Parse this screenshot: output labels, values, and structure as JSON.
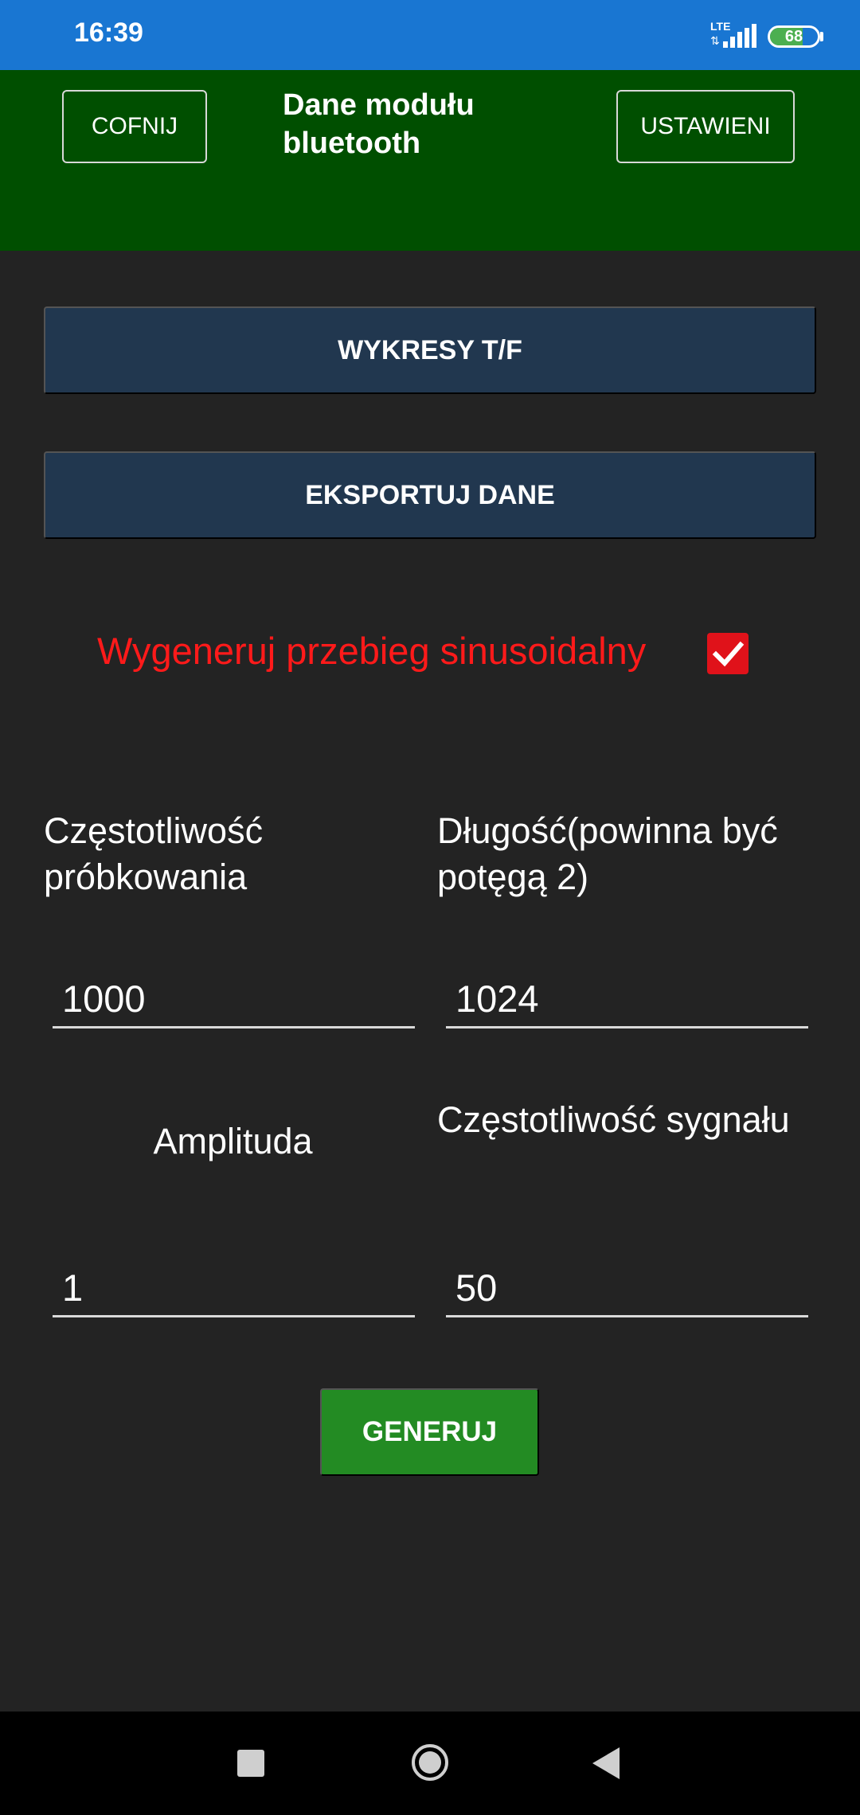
{
  "status_bar": {
    "time": "16:39",
    "network": "LTE",
    "battery": "68",
    "battery_level": 0.68
  },
  "header": {
    "back_label": "COFNIJ",
    "title": "Dane modułu bluetooth",
    "settings_label": "USTAWIENI"
  },
  "actions": {
    "charts_label": "WYKRESY T/F",
    "export_label": "EKSPORTUJ DANE"
  },
  "sine_toggle": {
    "label": "Wygeneruj przebieg sinusoidalny",
    "checked": true
  },
  "form": {
    "sampling_label": "Częstotliwość próbkowania",
    "sampling_value": "1000",
    "length_label": "Długość(powinna być potęgą 2)",
    "length_value": "1024",
    "amplitude_label": "Amplituda",
    "amplitude_value": "1",
    "signal_freq_label": "Częstotliwość sygnału",
    "signal_freq_value": "50"
  },
  "generate_label": "GENERUJ",
  "colors": {
    "status_bar": "#1976d2",
    "header": "#004f00",
    "background": "#232323",
    "action_button": "#21374f",
    "generate_button": "#238b23",
    "sine_label": "#ff1a1a",
    "checkbox": "#e0121a"
  },
  "nav": {
    "icons": [
      "square-recents-icon",
      "circle-home-icon",
      "triangle-back-icon"
    ]
  }
}
